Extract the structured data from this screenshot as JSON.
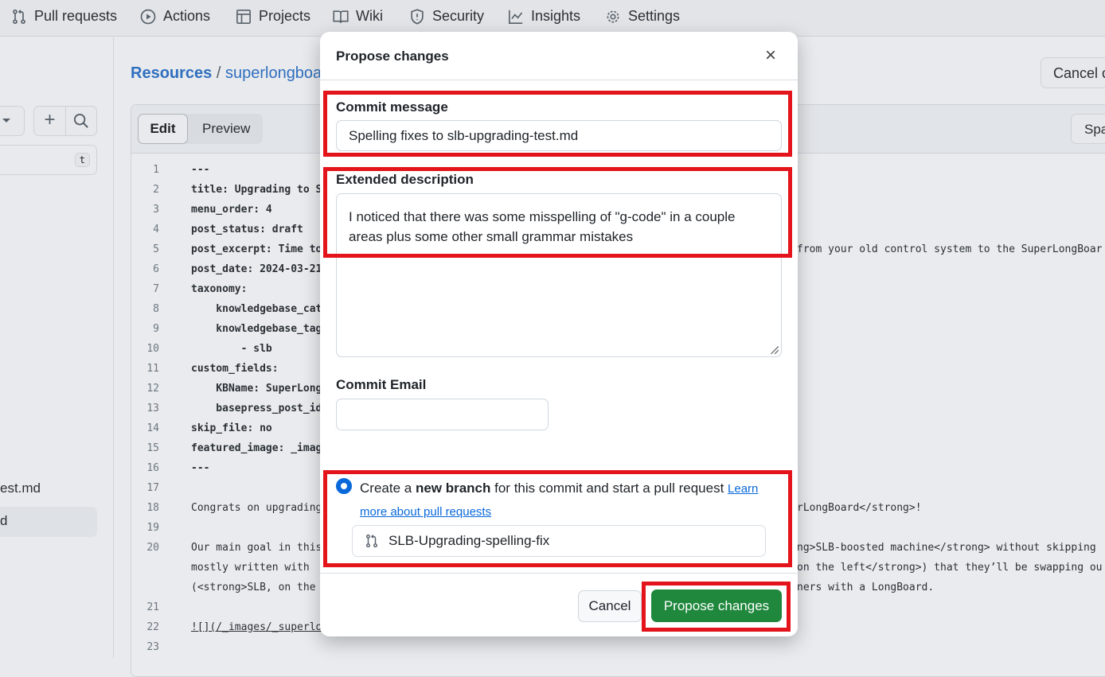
{
  "nav": {
    "items": [
      {
        "label": "Pull requests",
        "icon": "git-pull-request-icon"
      },
      {
        "label": "Actions",
        "icon": "play-circle-icon"
      },
      {
        "label": "Projects",
        "icon": "table-icon"
      },
      {
        "label": "Wiki",
        "icon": "book-icon"
      },
      {
        "label": "Security",
        "icon": "shield-icon"
      },
      {
        "label": "Insights",
        "icon": "graph-icon"
      },
      {
        "label": "Settings",
        "icon": "gear-icon"
      }
    ]
  },
  "sidebar": {
    "filter_shortcut": "t",
    "files": [
      "est.md",
      "d"
    ]
  },
  "breadcrumb": {
    "root": "Resources",
    "sep": "/",
    "current": "superlongboar"
  },
  "header": {
    "cancel_label": "Cancel c"
  },
  "editor": {
    "tab_edit": "Edit",
    "tab_preview": "Preview",
    "spaces_label": "Spa",
    "lines": [
      {
        "n": "1",
        "text": "---",
        "bold": true
      },
      {
        "n": "2",
        "text": "title: Upgrading to S",
        "bold": true
      },
      {
        "n": "3",
        "text": "menu_order: 4",
        "bold": true
      },
      {
        "n": "4",
        "text": "post_status: draft",
        "bold": true
      },
      {
        "n": "5",
        "text": "post_excerpt: Time to",
        "bold": true,
        "right": "from your old control system to the SuperLongBoar"
      },
      {
        "n": "6",
        "text": "post_date: 2024-03-21",
        "bold": true
      },
      {
        "n": "7",
        "text": "taxonomy:",
        "bold": true
      },
      {
        "n": "8",
        "text": "    knowledgebase_cat",
        "bold": true
      },
      {
        "n": "9",
        "text": "    knowledgebase_tag",
        "bold": true
      },
      {
        "n": "10",
        "text": "        - slb",
        "bold": true
      },
      {
        "n": "11",
        "text": "custom_fields:",
        "bold": true
      },
      {
        "n": "12",
        "text": "    KBName: SuperLong",
        "bold": true
      },
      {
        "n": "13",
        "text": "    basepress_post_id",
        "bold": true
      },
      {
        "n": "14",
        "text": "skip_file: no",
        "bold": true
      },
      {
        "n": "15",
        "text": "featured_image: _imag",
        "bold": true
      },
      {
        "n": "16",
        "text": "---",
        "bold": true
      },
      {
        "n": "17",
        "text": ""
      },
      {
        "n": "18",
        "text": "Congrats on upgrading",
        "right": "rLongBoard</strong>!"
      },
      {
        "n": "19",
        "text": ""
      },
      {
        "n": "20",
        "text": "Our main goal in this",
        "right": "ng>SLB-boosted machine</strong> without skipping "
      },
      {
        "n": "",
        "text": "mostly written with ",
        "right": "on the left</strong>) that they’ll be swapping ou"
      },
      {
        "n": "",
        "text": "(<strong>SLB, on the ",
        "right": "ners with a LongBoard."
      },
      {
        "n": "21",
        "text": ""
      },
      {
        "n": "22",
        "text": "![](/_images/_superlo",
        "link": true
      },
      {
        "n": "23",
        "text": ""
      }
    ]
  },
  "modal": {
    "title": "Propose changes",
    "commit_message_label": "Commit message",
    "commit_message_value": "Spelling fixes to slb-upgrading-test.md",
    "extended_label": "Extended description",
    "extended_value": "I noticed that there was some misspelling of \"g-code\" in a couple areas plus some other small grammar mistakes",
    "email_label": "Commit Email",
    "email_value": "",
    "radio_pre": "Create a ",
    "radio_bold": "new branch",
    "radio_post": " for this commit and start a pull request ",
    "radio_link": "Learn more about pull requests",
    "radio_selected": true,
    "branch_name": "SLB-Upgrading-spelling-fix",
    "cancel_label": "Cancel",
    "submit_label": "Propose changes",
    "colors": {
      "highlight": "#e3141c",
      "primary": "#1f883d",
      "link": "#0969da"
    }
  }
}
